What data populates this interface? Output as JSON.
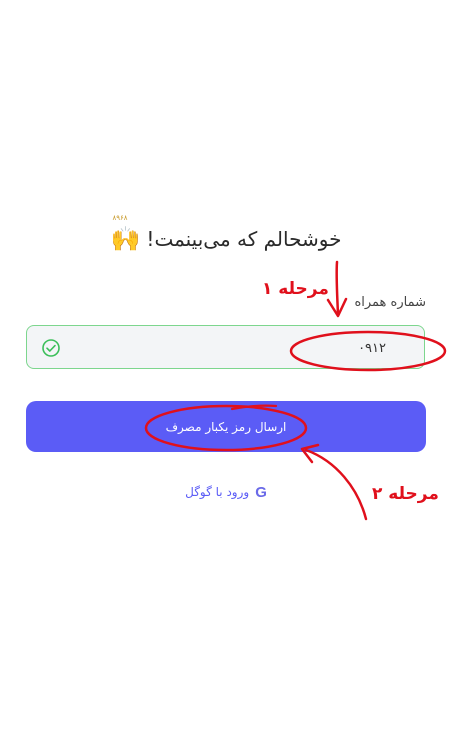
{
  "greeting": {
    "text": "خوشحالم که می‌بینمت!",
    "emoji": "🙌",
    "emoji_caption": "۸۹۶۸"
  },
  "phone": {
    "label": "شماره همراه",
    "value": "۰۹۱۲",
    "valid": true
  },
  "actions": {
    "send_otp": "ارسال رمز یکبار مصرف",
    "google_login": "ورود با گوگل",
    "google_icon": "G"
  },
  "annotations": {
    "step1": "مرحله ۱",
    "step2": "مرحله ۲",
    "color": "#e0101c"
  },
  "colors": {
    "primary": "#5b5cf6",
    "success": "#3cbf5a"
  }
}
